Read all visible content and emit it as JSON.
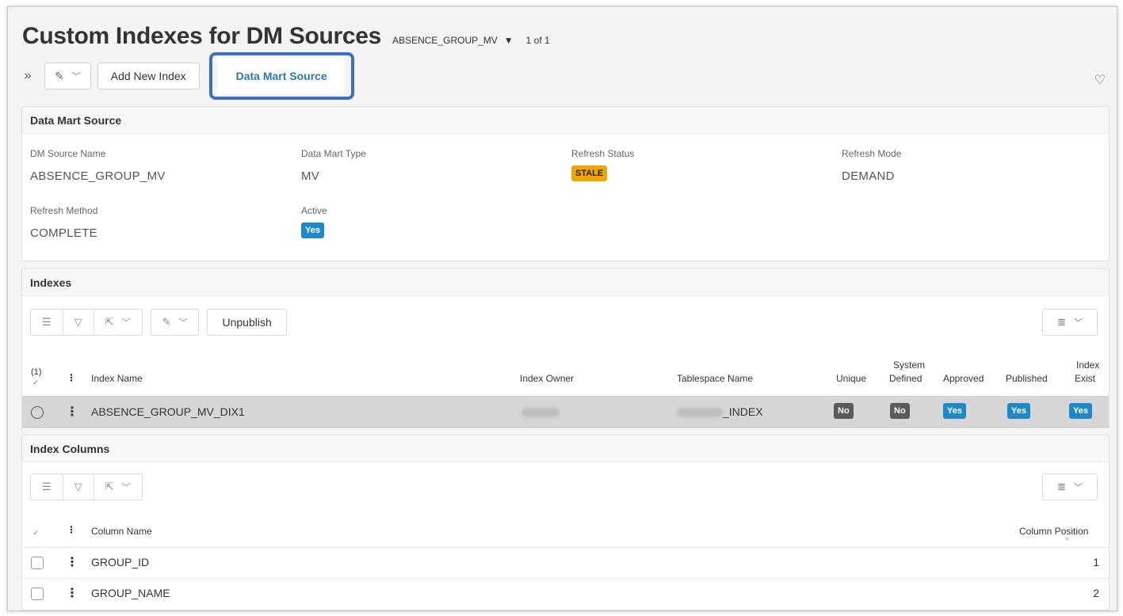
{
  "header": {
    "title": "Custom Indexes for DM Sources",
    "selector_value": "ABSENCE_GROUP_MV",
    "record_count": "1 of 1"
  },
  "toolbar": {
    "add_index_label": "Add New Index",
    "data_mart_source_label": "Data Mart Source"
  },
  "dm_source_panel": {
    "title": "Data Mart Source",
    "fields": {
      "dm_source_name": {
        "label": "DM Source Name",
        "value": "ABSENCE_GROUP_MV"
      },
      "data_mart_type": {
        "label": "Data Mart Type",
        "value": "MV"
      },
      "refresh_status": {
        "label": "Refresh Status",
        "value": "STALE"
      },
      "refresh_mode": {
        "label": "Refresh Mode",
        "value": "DEMAND"
      },
      "refresh_method": {
        "label": "Refresh Method",
        "value": "COMPLETE"
      },
      "active": {
        "label": "Active",
        "value": "Yes"
      }
    }
  },
  "indexes_panel": {
    "title": "Indexes",
    "unpublish_label": "Unpublish",
    "selected_count": "(1)",
    "columns": {
      "index_name": "Index Name",
      "index_owner": "Index Owner",
      "tablespace_name": "Tablespace Name",
      "unique": "Unique",
      "system_defined_1": "System",
      "system_defined_2": "Defined",
      "approved": "Approved",
      "published": "Published",
      "index_exist_1": "Index",
      "index_exist_2": "Exist"
    },
    "rows": [
      {
        "index_name": "ABSENCE_GROUP_MV_DIX1",
        "tablespace_suffix": "_INDEX",
        "unique": "No",
        "system_defined": "No",
        "approved": "Yes",
        "published": "Yes",
        "index_exist": "Yes"
      }
    ]
  },
  "index_columns_panel": {
    "title": "Index Columns",
    "columns": {
      "column_name": "Column Name",
      "column_position": "Column Position"
    },
    "rows": [
      {
        "column_name": "GROUP_ID",
        "column_position": "1"
      },
      {
        "column_name": "GROUP_NAME",
        "column_position": "2"
      }
    ]
  }
}
